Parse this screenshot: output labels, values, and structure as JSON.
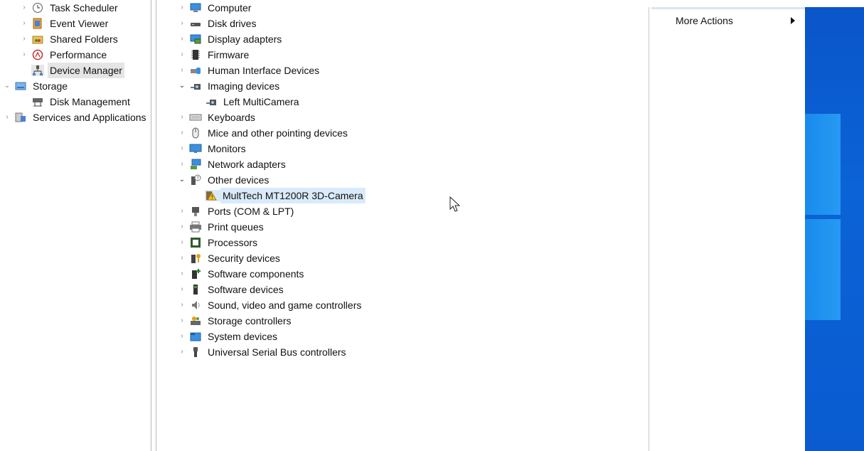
{
  "left_tree": {
    "items": [
      {
        "label": "Task Scheduler",
        "icon": "clock-icon",
        "expander": "›"
      },
      {
        "label": "Event Viewer",
        "icon": "event-viewer-icon",
        "expander": "›"
      },
      {
        "label": "Shared Folders",
        "icon": "shared-folder-icon",
        "expander": "›"
      },
      {
        "label": "Performance",
        "icon": "performance-icon",
        "expander": "›"
      },
      {
        "label": "Device Manager",
        "icon": "device-manager-icon",
        "expander": ""
      },
      {
        "label": "Storage",
        "icon": "storage-icon",
        "expander": "⌄"
      },
      {
        "label": "Disk Management",
        "icon": "disk-management-icon",
        "expander": ""
      },
      {
        "label": "Services and Applications",
        "icon": "services-icon",
        "expander": "›"
      }
    ]
  },
  "device_tree": {
    "items": [
      {
        "label": "Computer",
        "icon": "computer-icon",
        "expander": "›"
      },
      {
        "label": "Disk drives",
        "icon": "disk-drive-icon",
        "expander": "›"
      },
      {
        "label": "Display adapters",
        "icon": "display-adapter-icon",
        "expander": "›"
      },
      {
        "label": "Firmware",
        "icon": "firmware-icon",
        "expander": "›"
      },
      {
        "label": "Human Interface Devices",
        "icon": "hid-icon",
        "expander": "›"
      },
      {
        "label": "Imaging devices",
        "icon": "camera-icon",
        "expander": "⌄"
      },
      {
        "label": "Left MultiCamera",
        "icon": "camera-icon",
        "expander": ""
      },
      {
        "label": "Keyboards",
        "icon": "keyboard-icon",
        "expander": "›"
      },
      {
        "label": "Mice and other pointing devices",
        "icon": "mouse-icon",
        "expander": "›"
      },
      {
        "label": "Monitors",
        "icon": "monitor-icon",
        "expander": "›"
      },
      {
        "label": "Network adapters",
        "icon": "network-icon",
        "expander": "›"
      },
      {
        "label": "Other devices",
        "icon": "unknown-device-icon",
        "expander": "⌄"
      },
      {
        "label": "MultTech MT1200R 3D-Camera",
        "icon": "warning-device-icon",
        "expander": ""
      },
      {
        "label": "Ports (COM & LPT)",
        "icon": "port-icon",
        "expander": "›"
      },
      {
        "label": "Print queues",
        "icon": "printer-icon",
        "expander": "›"
      },
      {
        "label": "Processors",
        "icon": "processor-icon",
        "expander": "›"
      },
      {
        "label": "Security devices",
        "icon": "security-icon",
        "expander": "›"
      },
      {
        "label": "Software components",
        "icon": "software-component-icon",
        "expander": "›"
      },
      {
        "label": "Software devices",
        "icon": "software-device-icon",
        "expander": "›"
      },
      {
        "label": "Sound, video and game controllers",
        "icon": "speaker-icon",
        "expander": "›"
      },
      {
        "label": "Storage controllers",
        "icon": "storage-controller-icon",
        "expander": "›"
      },
      {
        "label": "System devices",
        "icon": "system-folder-icon",
        "expander": "›"
      },
      {
        "label": "Universal Serial Bus controllers",
        "icon": "usb-icon",
        "expander": "›"
      }
    ]
  },
  "actions": {
    "more_actions": "More Actions"
  },
  "colors": {
    "selection": "#e5e5e5",
    "hover_highlight": "#d9ebfa",
    "desktop_blue": "#0b63d6"
  }
}
